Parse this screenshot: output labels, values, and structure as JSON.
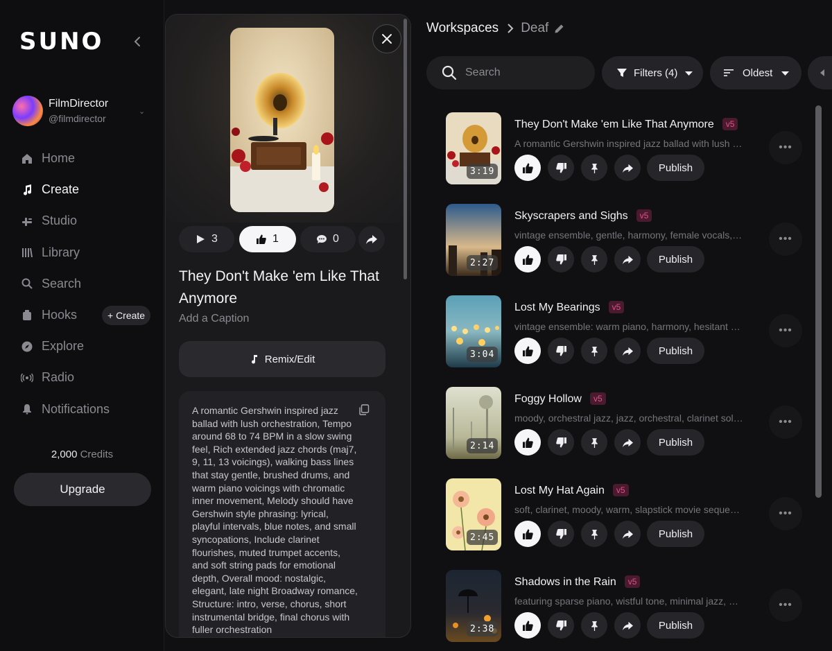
{
  "sidebar": {
    "logo": "SUNO",
    "profile": {
      "name": "FilmDirector",
      "handle": "@filmdirector"
    },
    "nav": [
      {
        "label": "Home",
        "icon": "home-icon"
      },
      {
        "label": "Create",
        "icon": "music-note-icon",
        "active": true
      },
      {
        "label": "Studio",
        "icon": "studio-icon"
      },
      {
        "label": "Library",
        "icon": "library-icon"
      },
      {
        "label": "Search",
        "icon": "search-icon"
      },
      {
        "label": "Hooks",
        "icon": "hooks-icon"
      },
      {
        "label": "Explore",
        "icon": "compass-icon"
      },
      {
        "label": "Radio",
        "icon": "radio-icon"
      },
      {
        "label": "Notifications",
        "icon": "bell-icon"
      }
    ],
    "hooks_create_label": "+ Create",
    "credits_value": "2,000",
    "credits_label": "Credits",
    "upgrade_label": "Upgrade"
  },
  "detail": {
    "plays": "3",
    "likes": "1",
    "comments": "0",
    "title": "They Don't Make 'em Like That Anymore",
    "caption_placeholder": "Add a Caption",
    "remix_label": "Remix/Edit",
    "prompt": "A romantic Gershwin inspired jazz ballad with lush orchestration, Tempo around 68 to 74 BPM in a slow swing feel, Rich extended jazz chords (maj7, 9, 11, 13 voicings), walking bass lines that stay gentle, brushed drums, and warm piano voicings with chromatic inner movement, Melody should have Gershwin style phrasing: lyrical, playful intervals, blue notes, and small syncopations, Include clarinet flourishes, muted trumpet accents, and soft string pads for emotional depth, Overall mood: nostalgic, elegant, late night Broadway romance, Structure: intro, verse, chorus, short instrumental bridge, final chorus with fuller orchestration"
  },
  "header": {
    "breadcrumb_root": "Workspaces",
    "breadcrumb_current": "Deaf",
    "search_placeholder": "Search",
    "filters_label": "Filters (4)",
    "sort_label": "Oldest"
  },
  "songs": [
    {
      "title": "They Don't Make 'em Like That Anymore",
      "version": "v5",
      "description": "A romantic Gershwin inspired jazz ballad with lush or...",
      "duration": "3:19"
    },
    {
      "title": "Skyscrapers and Sighs",
      "version": "v5",
      "description": "vintage ensemble, gentle, harmony, female vocals, cl...",
      "duration": "2:27"
    },
    {
      "title": "Lost My Bearings",
      "version": "v5",
      "description": "vintage ensemble: warm piano, harmony, hesitant ph...",
      "duration": "3:04"
    },
    {
      "title": "Foggy Hollow",
      "version": "v5",
      "description": "moody, orchestral jazz, jazz, orchestral, clarinet solo, ...",
      "duration": "2:14"
    },
    {
      "title": "Lost My Hat Again",
      "version": "v5",
      "description": "soft, clarinet, moody, warm, slapstick movie sequenc...",
      "duration": "2:45"
    },
    {
      "title": "Shadows in the Rain",
      "version": "v5",
      "description": "featuring sparse piano, wistful tone, minimal jazz, and...",
      "duration": "2:38"
    }
  ],
  "row_actions": {
    "publish_label": "Publish"
  },
  "colors": {
    "accent_badge_bg": "#4a1a2e",
    "accent_badge_text": "#e0508a",
    "background": "#101012"
  }
}
